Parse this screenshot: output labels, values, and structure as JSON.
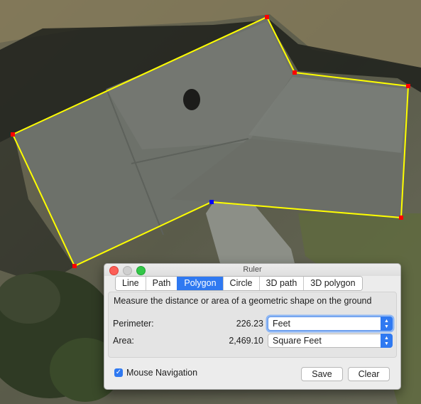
{
  "window": {
    "title": "Ruler"
  },
  "tabs": [
    {
      "label": "Line",
      "active": false
    },
    {
      "label": "Path",
      "active": false
    },
    {
      "label": "Polygon",
      "active": true
    },
    {
      "label": "Circle",
      "active": false
    },
    {
      "label": "3D path",
      "active": false
    },
    {
      "label": "3D polygon",
      "active": false
    }
  ],
  "panel": {
    "description": "Measure the distance or area of a geometric shape on the ground",
    "perimeter": {
      "label": "Perimeter:",
      "value": "226.23",
      "unit": "Feet"
    },
    "area": {
      "label": "Area:",
      "value": "2,469.10",
      "unit": "Square Feet"
    }
  },
  "footer": {
    "mouse_navigation_label": "Mouse Navigation",
    "mouse_navigation_checked": true,
    "save_label": "Save",
    "clear_label": "Clear"
  },
  "colors": {
    "polygon_outline": "#ffff00",
    "vertex": "#ff0000",
    "active_vertex": "#0000ff",
    "accent": "#2f79f1"
  }
}
